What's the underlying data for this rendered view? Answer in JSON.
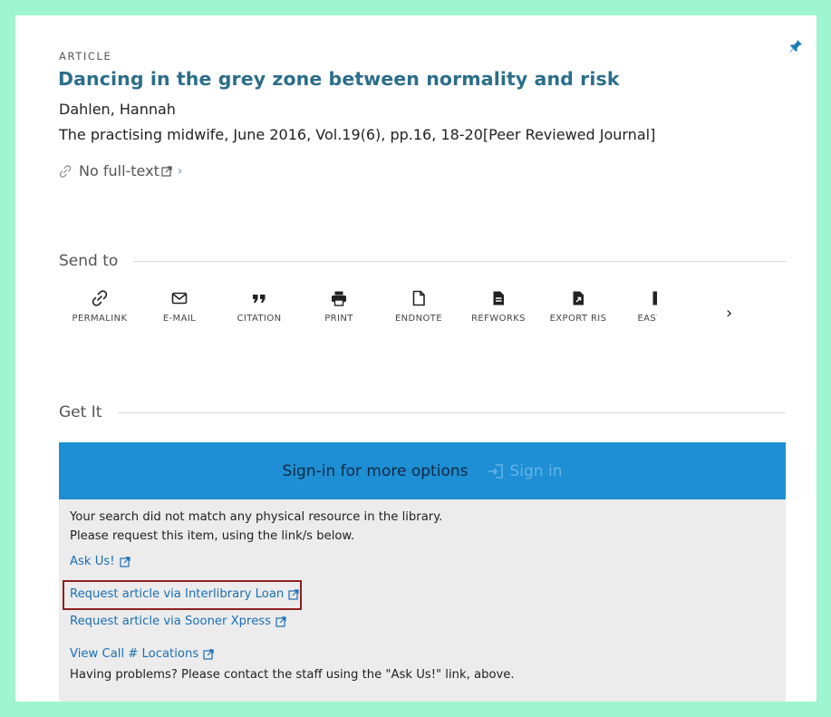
{
  "record": {
    "type_label": "ARTICLE",
    "title": "Dancing in the grey zone between normality and risk",
    "author": "Dahlen, Hannah",
    "citation": "The practising midwife, June 2016, Vol.19(6), pp.16, 18-20[Peer Reviewed Journal]",
    "fulltext_label": "No full-text",
    "fulltext_chevron": "›"
  },
  "send_to": {
    "heading": "Send to",
    "actions": [
      {
        "label": "PERMALINK",
        "icon": "link-icon"
      },
      {
        "label": "E-MAIL",
        "icon": "mail-icon"
      },
      {
        "label": "CITATION",
        "icon": "quote-icon"
      },
      {
        "label": "PRINT",
        "icon": "printer-icon"
      },
      {
        "label": "ENDNOTE",
        "icon": "document-icon"
      },
      {
        "label": "REFWORKS",
        "icon": "document-lines-icon"
      },
      {
        "label": "EXPORT RIS",
        "icon": "document-export-icon"
      },
      {
        "label": "EASYBIB",
        "icon": "document-icon"
      }
    ],
    "next_arrow": "›"
  },
  "get_it": {
    "heading": "Get It",
    "signin_message": "Sign-in for more options",
    "signin_button": "Sign in",
    "no_match_line1": "Your search did not match any physical resource in the library.",
    "no_match_line2": "Please request this item, using the link/s below.",
    "links": [
      "Ask Us!",
      "Request article via Interlibrary Loan",
      "Request article via Sooner Xpress",
      "View Call # Locations"
    ],
    "help_text": "Having problems? Please contact the staff using the \"Ask Us!\" link, above."
  },
  "colors": {
    "page_background": "#9ff5cf",
    "title": "#2c6e8a",
    "signin_bar": "#1e8fd4",
    "link": "#1a6fb5",
    "highlight_border": "#8e2020"
  }
}
